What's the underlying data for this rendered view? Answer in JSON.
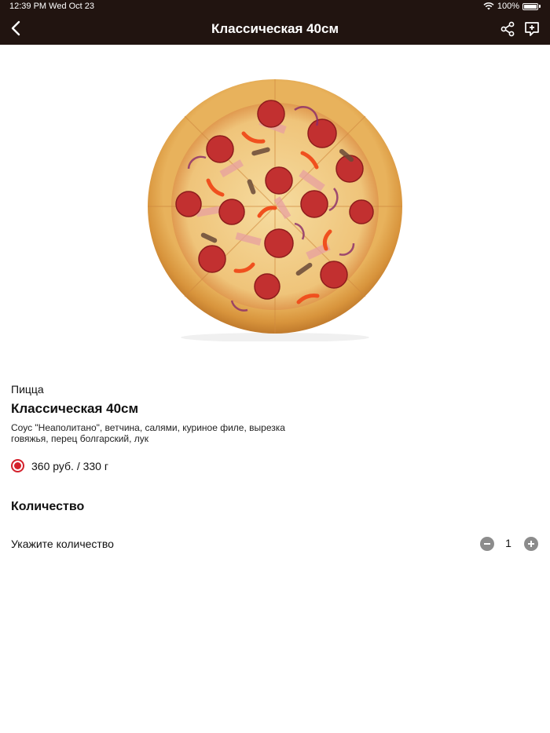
{
  "status_bar": {
    "time_date": "12:39 PM  Wed Oct 23",
    "battery": "100%"
  },
  "nav": {
    "title": "Классическая 40см",
    "back_icon": "chevron-left-icon",
    "share_icon": "share-icon",
    "cart_icon": "add-to-cart-icon"
  },
  "product": {
    "category": "Пицца",
    "name": "Классическая 40см",
    "description": "Соус \"Неаполитано\", ветчина, салями, куриное филе, вырезка говяжья, перец болгарский, лук",
    "price_option": "360 руб. / 330 г",
    "price_option_selected": true
  },
  "quantity": {
    "section_title": "Количество",
    "label": "Укажите количество",
    "value": "1"
  },
  "colors": {
    "header_bg": "#211410",
    "accent": "#d4212c",
    "stepper": "#8c8c8c"
  }
}
